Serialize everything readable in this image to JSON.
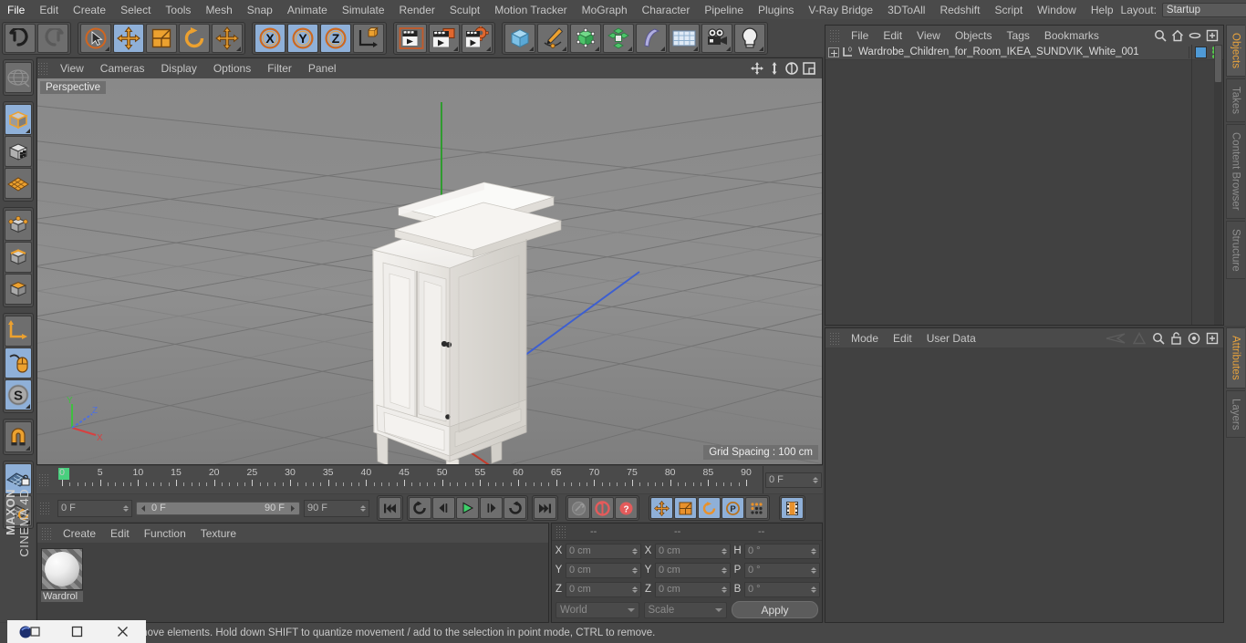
{
  "app": {
    "name": "Cinema 4D",
    "brand_line1": "MAXON",
    "brand_line2": "CINEMA 4D"
  },
  "menubar": {
    "items": [
      {
        "label": "File"
      },
      {
        "label": "Edit"
      },
      {
        "label": "Create"
      },
      {
        "label": "Select"
      },
      {
        "label": "Tools"
      },
      {
        "label": "Mesh"
      },
      {
        "label": "Snap"
      },
      {
        "label": "Animate"
      },
      {
        "label": "Simulate"
      },
      {
        "label": "Render"
      },
      {
        "label": "Sculpt"
      },
      {
        "label": "Motion Tracker"
      },
      {
        "label": "MoGraph"
      },
      {
        "label": "Character"
      },
      {
        "label": "Pipeline"
      },
      {
        "label": "Plugins"
      },
      {
        "label": "V-Ray Bridge"
      },
      {
        "label": "3DToAll"
      },
      {
        "label": "Redshift"
      },
      {
        "label": "Script"
      },
      {
        "label": "Window"
      },
      {
        "label": "Help"
      }
    ],
    "layout_label": "Layout:",
    "layout_value": "Startup",
    "search_icon": "search-icon"
  },
  "toolbar": {
    "groups": [
      {
        "name": "history",
        "buttons": [
          {
            "name": "undo-button",
            "icon": "undo-arrow-icon",
            "active": false,
            "corner": false
          },
          {
            "name": "redo-button",
            "icon": "redo-arrow-icon",
            "active": false,
            "corner": false
          }
        ]
      },
      {
        "name": "transform-tools",
        "buttons": [
          {
            "name": "live-selection-tool",
            "icon": "cursor-selection-icon",
            "active": false,
            "corner": true
          },
          {
            "name": "move-tool",
            "icon": "move-arrows-icon",
            "active": true,
            "corner": false
          },
          {
            "name": "scale-tool",
            "icon": "scale-box-icon",
            "active": false,
            "corner": false
          },
          {
            "name": "rotate-tool",
            "icon": "rotate-circle-icon",
            "active": false,
            "corner": false
          },
          {
            "name": "move-alt-tool",
            "icon": "move-arrows-icon",
            "active": false,
            "corner": true
          }
        ]
      },
      {
        "name": "axis-locks",
        "buttons": [
          {
            "name": "lock-x-axis-button",
            "icon": "x-axis-icon",
            "label": "X",
            "active": true,
            "corner": false
          },
          {
            "name": "lock-y-axis-button",
            "icon": "y-axis-icon",
            "label": "Y",
            "active": true,
            "corner": false
          },
          {
            "name": "lock-z-axis-button",
            "icon": "z-axis-icon",
            "label": "Z",
            "active": true,
            "corner": false
          },
          {
            "name": "world-object-coordinate-button",
            "icon": "coordinate-system-icon",
            "active": false,
            "corner": false
          }
        ]
      },
      {
        "name": "render-tools",
        "buttons": [
          {
            "name": "render-view-button",
            "icon": "render-view-icon",
            "active": false,
            "corner": false
          },
          {
            "name": "render-to-picture-viewer-button",
            "icon": "render-picture-viewer-icon",
            "active": false,
            "corner": true
          },
          {
            "name": "render-settings-button",
            "icon": "render-settings-gear-icon",
            "active": false,
            "corner": true
          }
        ]
      },
      {
        "name": "create-objects",
        "buttons": [
          {
            "name": "add-cube-button",
            "icon": "cube-primitive-icon",
            "active": false,
            "corner": true
          },
          {
            "name": "add-spline-button",
            "icon": "pen-spline-icon",
            "active": false,
            "corner": true
          },
          {
            "name": "add-generator-button",
            "icon": "generator-cube-icon",
            "active": false,
            "corner": true
          },
          {
            "name": "add-deformer-button",
            "icon": "deformer-cluster-icon",
            "active": false,
            "corner": true
          },
          {
            "name": "add-scene-object-button",
            "icon": "bend-scene-icon",
            "active": false,
            "corner": true
          },
          {
            "name": "add-environment-button",
            "icon": "floor-grid-icon",
            "active": false,
            "corner": true
          },
          {
            "name": "add-camera-button",
            "icon": "camera-icon",
            "active": false,
            "corner": true
          },
          {
            "name": "add-light-button",
            "icon": "light-bulb-icon",
            "active": false,
            "corner": true
          }
        ]
      }
    ]
  },
  "leftbar": {
    "groups": [
      {
        "name": "undo-view",
        "buttons": [
          {
            "name": "undo-view-button",
            "icon": "globe-wire-icon",
            "active": false,
            "corner": false
          }
        ]
      },
      {
        "name": "editable-modes",
        "buttons": [
          {
            "name": "make-editable-button",
            "icon": "editable-cube-icon",
            "active": true,
            "corner": true
          },
          {
            "name": "model-mode-button",
            "icon": "checker-cube-icon",
            "active": false,
            "corner": false
          },
          {
            "name": "texture-mode-button",
            "icon": "texture-grid-icon",
            "active": false,
            "corner": false
          }
        ]
      },
      {
        "name": "component-modes",
        "buttons": [
          {
            "name": "points-mode-button",
            "icon": "points-cube-icon",
            "active": false,
            "corner": false
          },
          {
            "name": "edges-mode-button",
            "icon": "edges-cube-icon",
            "active": false,
            "corner": false
          },
          {
            "name": "polygons-mode-button",
            "icon": "polygons-cube-icon",
            "active": false,
            "corner": false
          }
        ]
      },
      {
        "name": "axis-tools",
        "buttons": [
          {
            "name": "enable-axis-modification-button",
            "icon": "axis-l-icon",
            "active": false,
            "corner": false
          },
          {
            "name": "viewport-solo-button",
            "icon": "mouse-icon",
            "active": true,
            "corner": false
          },
          {
            "name": "enable-snapping-button",
            "icon": "snap-s-icon",
            "active": true,
            "corner": true
          }
        ]
      },
      {
        "name": "magnet",
        "buttons": [
          {
            "name": "magnet-tool-button",
            "icon": "magnet-icon",
            "active": false,
            "corner": true
          }
        ]
      },
      {
        "name": "workplane",
        "buttons": [
          {
            "name": "lock-workplane-button",
            "icon": "workplane-lock-icon",
            "active": true,
            "corner": false
          },
          {
            "name": "rotate-workplane-button",
            "icon": "workplane-rotate-icon",
            "active": false,
            "corner": true
          }
        ]
      }
    ]
  },
  "viewport": {
    "menu": [
      {
        "label": "View"
      },
      {
        "label": "Cameras"
      },
      {
        "label": "Display"
      },
      {
        "label": "Options"
      },
      {
        "label": "Filter"
      },
      {
        "label": "Panel"
      }
    ],
    "nav_icons": [
      {
        "name": "pan-view-icon"
      },
      {
        "name": "dolly-view-icon"
      },
      {
        "name": "rotate-view-icon"
      },
      {
        "name": "maximize-view-icon"
      }
    ],
    "label": "Perspective",
    "grid_spacing": "Grid Spacing : 100 cm",
    "axis_gizmo": {
      "x": "X",
      "y": "Y",
      "z": "Z",
      "x_color": "#d84040",
      "y_color": "#3fbf3f",
      "z_color": "#4d6fe0"
    },
    "model": "Wardrobe_Children_for_Room_IKEA_SUNDVIK_White_001"
  },
  "timeline": {
    "ticks": [
      0,
      5,
      10,
      15,
      20,
      25,
      30,
      35,
      40,
      45,
      50,
      55,
      60,
      65,
      70,
      75,
      80,
      85,
      90
    ],
    "current_frame_field": "0 F",
    "start_frame": "0 F",
    "end_frame": "90 F",
    "preview_end": "90 F",
    "range_start_label": "0 F",
    "range_end_label": "90 F"
  },
  "transport": {
    "buttons": [
      {
        "name": "go-to-start-button",
        "icon": "skip-start-icon",
        "active": false
      },
      {
        "name": "go-to-previous-key-button",
        "icon": "previous-key-icon",
        "active": false
      },
      {
        "name": "step-back-button",
        "icon": "step-back-icon",
        "active": false
      },
      {
        "name": "play-button",
        "icon": "play-icon",
        "active": false
      },
      {
        "name": "step-forward-button",
        "icon": "step-forward-icon",
        "active": false
      },
      {
        "name": "go-to-next-key-button",
        "icon": "next-key-icon",
        "active": false
      },
      {
        "name": "go-to-end-button",
        "icon": "skip-end-icon",
        "active": false
      }
    ],
    "key_buttons": [
      {
        "name": "record-active-objects-button",
        "icon": "key-wrench-icon"
      },
      {
        "name": "autokeying-button",
        "icon": "autokey-circle-icon"
      },
      {
        "name": "keyframe-selection-button",
        "icon": "keyframe-question-icon"
      }
    ],
    "mode_buttons": [
      {
        "name": "position-key-button",
        "icon": "move-arrows-icon",
        "active": true
      },
      {
        "name": "scale-key-button",
        "icon": "scale-box-icon",
        "active": true
      },
      {
        "name": "rotation-key-button",
        "icon": "rotate-circle-icon",
        "active": true
      },
      {
        "name": "parameter-key-button",
        "icon": "parameter-p-icon",
        "active": true
      },
      {
        "name": "point-level-animation-button",
        "icon": "pla-dots-icon",
        "active": false
      }
    ],
    "timeline_toggle": {
      "name": "timeline-toggle-button",
      "icon": "film-strip-icon",
      "active": true
    }
  },
  "material_manager": {
    "menu": [
      {
        "label": "Create"
      },
      {
        "label": "Edit"
      },
      {
        "label": "Function"
      },
      {
        "label": "Texture"
      }
    ],
    "materials": [
      {
        "name": "Wardrol",
        "preview": "sphere-preview"
      }
    ]
  },
  "coordinates": {
    "headers": [
      "--",
      "--",
      "--"
    ],
    "position": {
      "label_x": "X",
      "label_y": "Y",
      "label_z": "Z",
      "x": "0 cm",
      "y": "0 cm",
      "z": "0 cm"
    },
    "size": {
      "label_x": "X",
      "label_y": "Y",
      "label_z": "Z",
      "x": "0 cm",
      "y": "0 cm",
      "z": "0 cm"
    },
    "rotation": {
      "label_h": "H",
      "label_p": "P",
      "label_b": "B",
      "h": "0 °",
      "p": "0 °",
      "b": "0 °"
    },
    "coord_system": "World",
    "size_mode": "Scale",
    "apply_label": "Apply"
  },
  "object_manager": {
    "menu": [
      {
        "label": "File"
      },
      {
        "label": "Edit"
      },
      {
        "label": "View"
      },
      {
        "label": "Objects"
      },
      {
        "label": "Tags"
      },
      {
        "label": "Bookmarks"
      }
    ],
    "tools": [
      {
        "name": "search-objects-icon"
      },
      {
        "name": "home-icon"
      },
      {
        "name": "ellipse-icon"
      },
      {
        "name": "expand-panel-icon"
      }
    ],
    "rows": [
      {
        "name": "Wardrobe_Children_for_Room_IKEA_SUNDVIK_White_001",
        "expandable": true,
        "layer_badge": "0",
        "tag_color": "#4f9ad6",
        "has_dots": true
      }
    ]
  },
  "attributes": {
    "menu": [
      {
        "label": "Mode"
      },
      {
        "label": "Edit"
      },
      {
        "label": "User Data"
      }
    ],
    "tools": [
      {
        "name": "history-back-icon"
      },
      {
        "name": "history-forward-icon"
      },
      {
        "name": "search-attributes-icon"
      },
      {
        "name": "lock-icon"
      },
      {
        "name": "pin-target-icon"
      },
      {
        "name": "expand-panel-icon"
      }
    ]
  },
  "side_tabs": {
    "top": [
      {
        "label": "Objects",
        "active": true
      },
      {
        "label": "Takes",
        "active": false
      },
      {
        "label": "Content Browser",
        "active": false
      },
      {
        "label": "Structure",
        "active": false
      }
    ],
    "bottom": [
      {
        "label": "Attributes",
        "active": true
      },
      {
        "label": "Layers",
        "active": false
      }
    ]
  },
  "statusbar": {
    "text": "move elements. Hold down SHIFT to quantize movement / add to the selection in point mode, CTRL to remove."
  },
  "taskbar": {
    "buttons": [
      {
        "name": "app-icon",
        "icon": "c4d-logo-icon"
      },
      {
        "name": "restore-window-button",
        "icon": "restore-square-icon"
      },
      {
        "name": "close-window-button",
        "icon": "close-x-icon"
      }
    ]
  },
  "colors": {
    "accent_orange": "#e8a33d",
    "active_blue": "#8fb0d8",
    "panel_bg": "#414141",
    "toolbar_bg": "#474747"
  }
}
